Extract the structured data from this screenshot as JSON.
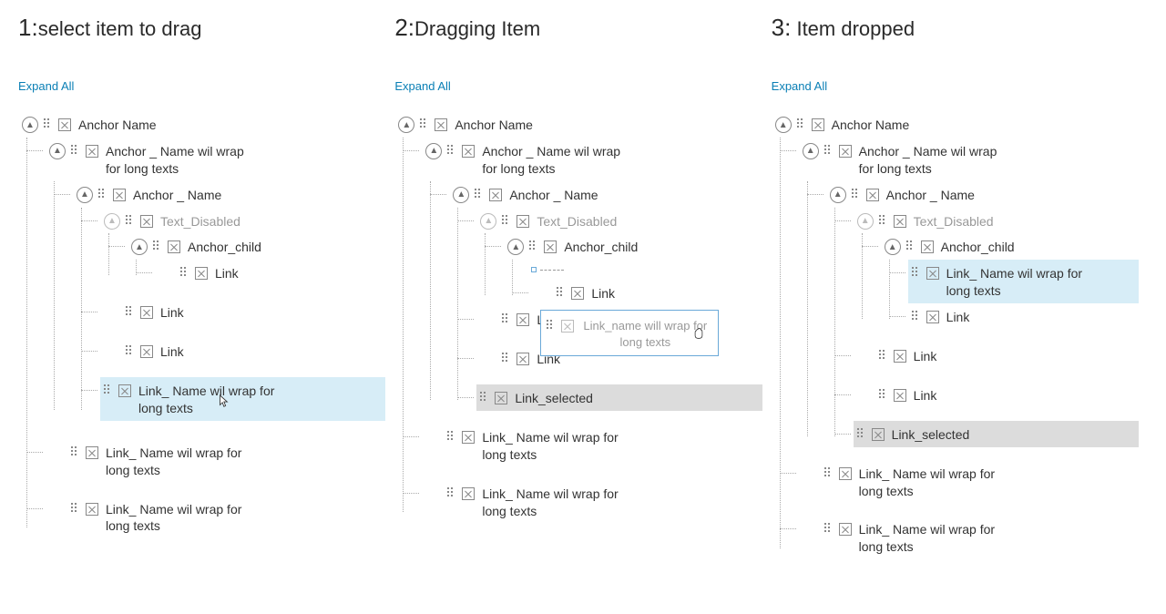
{
  "colors": {
    "accent": "#0a7fb5",
    "selected_bg": "#d7edf7",
    "selected_gray": "#dcdcdc"
  },
  "columns": [
    {
      "num": "1:",
      "title": "select item to drag",
      "expand": "Expand All",
      "tree": {
        "root": "Anchor Name",
        "anchor_wrap": "Anchor _ Name wil wrap for long texts",
        "anchor_name": "Anchor _ Name",
        "text_disabled": "Text_Disabled",
        "anchor_child": "Anchor_child",
        "link5": "Link",
        "link_a": "Link",
        "link_b": "Link",
        "link_selected": "Link_ Name wil wrap for long texts",
        "link_wrap1": "Link_ Name wil wrap for long texts",
        "link_wrap2": "Link_ Name wil wrap for long texts"
      }
    },
    {
      "num": "2:",
      "title": "Dragging Item",
      "expand": "Expand All",
      "tree": {
        "root": "Anchor Name",
        "anchor_wrap": "Anchor _ Name wil wrap for long texts",
        "anchor_name": "Anchor _ Name",
        "text_disabled": "Text_Disabled",
        "anchor_child": "Anchor_child",
        "ghost": "Link_name will wrap for long texts",
        "link5": "Link",
        "link_a": "Link",
        "link_b": "Link",
        "link_selected": "Link_selected",
        "link_wrap1": "Link_ Name wil wrap for long texts",
        "link_wrap2": "Link_ Name wil wrap for long texts"
      }
    },
    {
      "num": "3:",
      "title": " Item dropped",
      "expand": "Expand All",
      "tree": {
        "root": "Anchor Name",
        "anchor_wrap": "Anchor _ Name wil wrap for long texts",
        "anchor_name": "Anchor _ Name",
        "text_disabled": "Text_Disabled",
        "anchor_child": "Anchor_child",
        "dropped": "Link_ Name wil wrap for long texts",
        "link5": "Link",
        "link_a": "Link",
        "link_b": "Link",
        "link_selected": "Link_selected",
        "link_wrap1": "Link_ Name wil wrap for long texts",
        "link_wrap2": "Link_ Name wil wrap for long texts"
      }
    }
  ]
}
